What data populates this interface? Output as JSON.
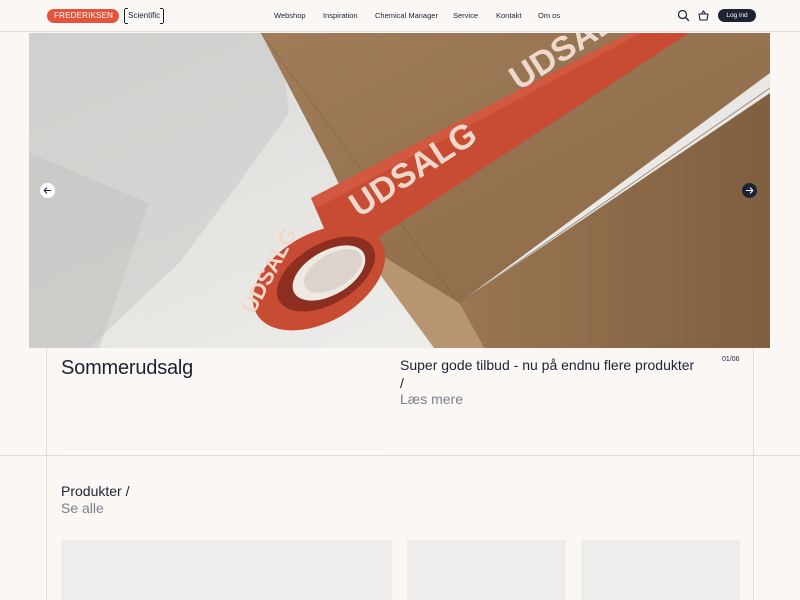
{
  "header": {
    "logo_brand": "FREDERIKSEN",
    "logo_sub": "Scientific",
    "nav": [
      "Webshop",
      "Inspiration",
      "Chemical Manager",
      "Service",
      "Kontakt",
      "Om os"
    ],
    "login_label": "Log ind",
    "icons": [
      "search-icon",
      "basket-icon"
    ]
  },
  "hero": {
    "tape_text": "UDSALG",
    "prev_icon": "arrow-left-icon",
    "next_icon": "arrow-right-icon"
  },
  "slide": {
    "title": "Sommerudsalg",
    "subtitle": "Super gode tilbud - nu på endnu flere produkter /",
    "more": "Læs mere",
    "counter": "01/06"
  },
  "products": {
    "title": "Produkter /",
    "see_all": "Se alle"
  },
  "colors": {
    "brand": "#e4543c",
    "ink": "#1d2333",
    "background": "#faf7f4"
  }
}
